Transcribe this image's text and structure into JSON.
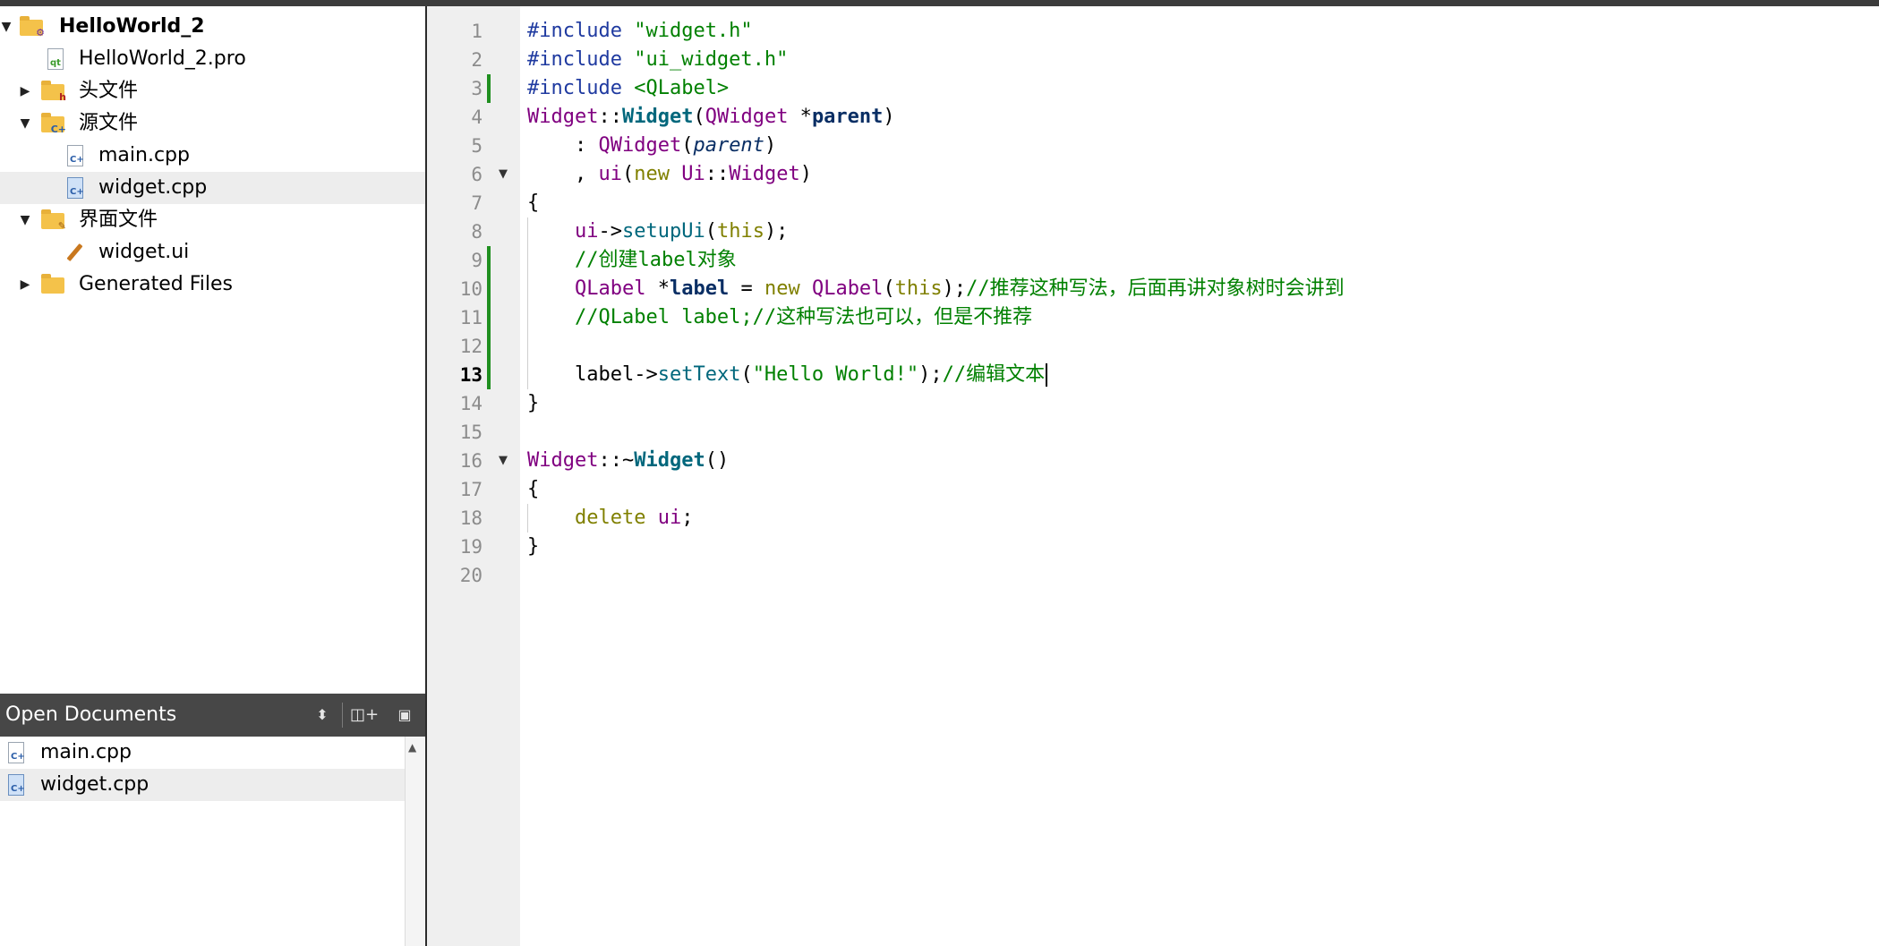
{
  "project_tree": {
    "root": "HelloWorld_2",
    "pro_file": "HelloWorld_2.pro",
    "headers_folder": "头文件",
    "sources_folder": "源文件",
    "sources": [
      "main.cpp",
      "widget.cpp"
    ],
    "forms_folder": "界面文件",
    "forms": [
      "widget.ui"
    ],
    "generated_folder": "Generated Files"
  },
  "open_documents": {
    "title": "Open Documents",
    "items": [
      "main.cpp",
      "widget.cpp"
    ],
    "selected": "widget.cpp"
  },
  "editor": {
    "current_line": 13,
    "line_numbers": [
      "1",
      "2",
      "3",
      "4",
      "5",
      "6",
      "7",
      "8",
      "9",
      "10",
      "11",
      "12",
      "13",
      "14",
      "15",
      "16",
      "17",
      "18",
      "19",
      "20"
    ],
    "t": {
      "l1a": "#include ",
      "l1b": "\"widget.h\"",
      "l2a": "#include ",
      "l2b": "\"ui_widget.h\"",
      "l3a": "#include ",
      "l3b": "<QLabel>",
      "l4a": "Widget",
      "l4b": "::",
      "l4c": "Widget",
      "l4d": "(",
      "l4e": "QWidget",
      "l4f": " *",
      "l4g": "parent",
      "l4h": ")",
      "l5a": "    : ",
      "l5b": "QWidget",
      "l5c": "(",
      "l5d": "parent",
      "l5e": ")",
      "l6a": "    , ",
      "l6b": "ui",
      "l6c": "(",
      "l6d": "new",
      "l6e": " ",
      "l6f": "Ui",
      "l6g": "::",
      "l6h": "Widget",
      "l6i": ")",
      "l7a": "{",
      "l8a": "    ",
      "l8b": "ui",
      "l8c": "->",
      "l8d": "setupUi",
      "l8e": "(",
      "l8f": "this",
      "l8g": ");",
      "l9a": "    ",
      "l9b": "//创建label对象",
      "l10a": "    ",
      "l10b": "QLabel",
      "l10c": " *",
      "l10d": "label",
      "l10e": " = ",
      "l10f": "new",
      "l10g": " ",
      "l10h": "QLabel",
      "l10i": "(",
      "l10j": "this",
      "l10k": ");",
      "l10l": "//推荐这种写法，后面再讲对象树时会讲到",
      "l11a": "    ",
      "l11b": "//QLabel label;//这种写法也可以，但是不推荐",
      "l13a": "    ",
      "l13b": "label",
      "l13c": "->",
      "l13d": "setText",
      "l13e": "(",
      "l13f": "\"Hello World!\"",
      "l13g": ");",
      "l13h": "//编辑文本",
      "l14a": "}",
      "l16a": "Widget",
      "l16b": "::~",
      "l16c": "Widget",
      "l16d": "()",
      "l17a": "{",
      "l18a": "    ",
      "l18b": "delete",
      "l18c": " ",
      "l18d": "ui",
      "l18e": ";",
      "l19a": "}"
    }
  }
}
